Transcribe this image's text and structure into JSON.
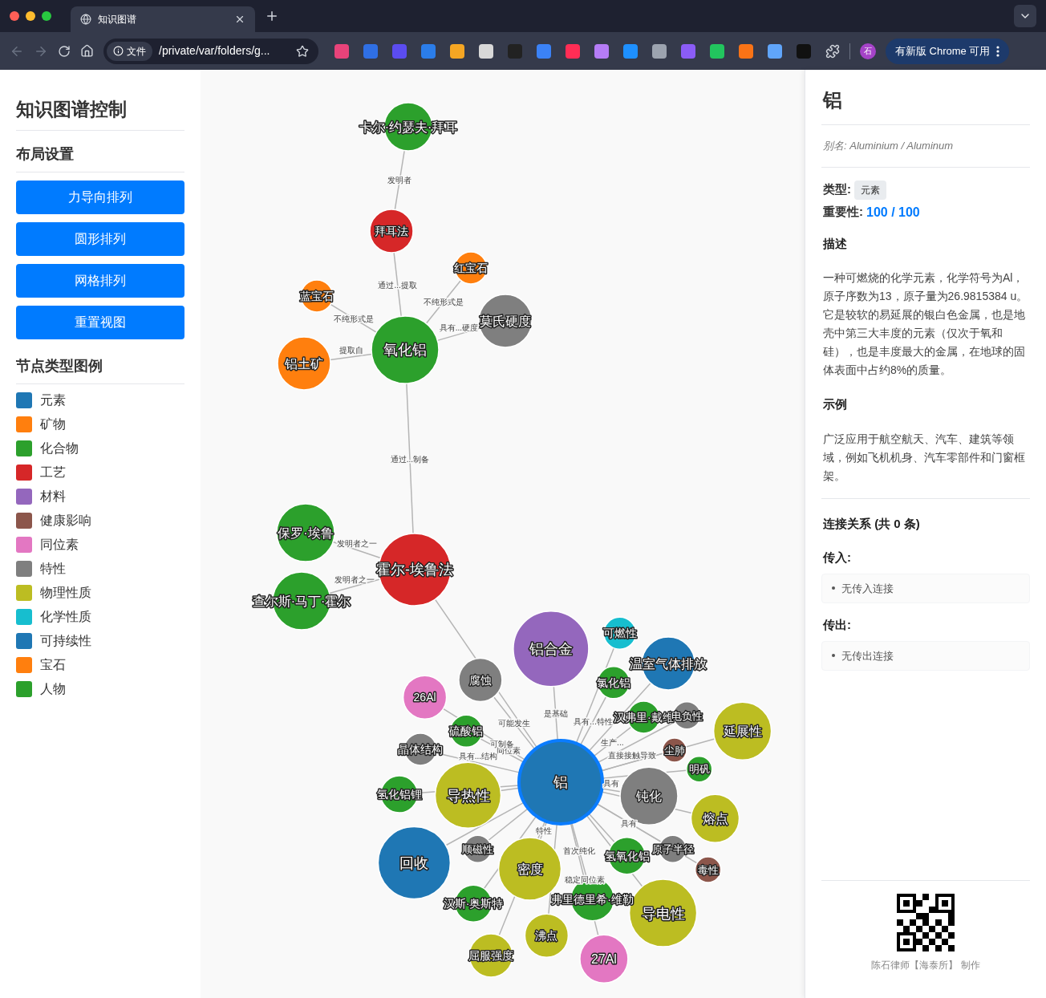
{
  "browser": {
    "tab_title": "知识图谱",
    "address_badge": "文件",
    "url": "/private/var/folders/g...",
    "profile": "石",
    "update_button": "有新版 Chrome 可用"
  },
  "sidebar": {
    "title": "知识图谱控制",
    "layout_heading": "布局设置",
    "buttons": [
      "力导向排列",
      "圆形排列",
      "网格排列",
      "重置视图"
    ],
    "legend_heading": "节点类型图例",
    "legend": [
      {
        "label": "元素",
        "color": "#1f77b4"
      },
      {
        "label": "矿物",
        "color": "#ff7f0e"
      },
      {
        "label": "化合物",
        "color": "#2ca02c"
      },
      {
        "label": "工艺",
        "color": "#d62728"
      },
      {
        "label": "材料",
        "color": "#9467bd"
      },
      {
        "label": "健康影响",
        "color": "#8c564b"
      },
      {
        "label": "同位素",
        "color": "#e377c2"
      },
      {
        "label": "特性",
        "color": "#7f7f7f"
      },
      {
        "label": "物理性质",
        "color": "#bcbd22"
      },
      {
        "label": "化学性质",
        "color": "#17becf"
      },
      {
        "label": "可持续性",
        "color": "#1f77b4"
      },
      {
        "label": "宝石",
        "color": "#ff7f0e"
      },
      {
        "label": "人物",
        "color": "#2ca02c"
      }
    ]
  },
  "graph": {
    "nodes": [
      {
        "label": "卡尔·约瑟夫·拜耳",
        "color": "#2ca02c",
        "selected": false
      },
      {
        "label": "拜耳法",
        "color": "#d62728",
        "selected": false
      },
      {
        "label": "红宝石",
        "color": "#ff7f0e",
        "selected": false
      },
      {
        "label": "蓝宝石",
        "color": "#ff7f0e",
        "selected": false
      },
      {
        "label": "莫氏硬度",
        "color": "#7f7f7f",
        "selected": false
      },
      {
        "label": "氧化铝",
        "color": "#2ca02c",
        "selected": false
      },
      {
        "label": "铝土矿",
        "color": "#ff7f0e",
        "selected": false
      },
      {
        "label": "保罗·埃鲁",
        "color": "#2ca02c",
        "selected": false
      },
      {
        "label": "霍尔-埃鲁法",
        "color": "#d62728",
        "selected": false
      },
      {
        "label": "查尔斯·马丁·霍尔",
        "color": "#2ca02c",
        "selected": false
      },
      {
        "label": "铝合金",
        "color": "#9467bd",
        "selected": false
      },
      {
        "label": "可燃性",
        "color": "#17becf",
        "selected": false
      },
      {
        "label": "温室气体排放",
        "color": "#1f77b4",
        "selected": false
      },
      {
        "label": "氯化铝",
        "color": "#2ca02c",
        "selected": false
      },
      {
        "label": "腐蚀",
        "color": "#7f7f7f",
        "selected": false
      },
      {
        "label": "26Al",
        "color": "#e377c2",
        "selected": false
      },
      {
        "label": "汉弗里·戴维",
        "color": "#2ca02c",
        "selected": false
      },
      {
        "label": "电负性",
        "color": "#7f7f7f",
        "selected": false
      },
      {
        "label": "延展性",
        "color": "#bcbd22",
        "selected": false
      },
      {
        "label": "硫酸铝",
        "color": "#2ca02c",
        "selected": false
      },
      {
        "label": "尘肺",
        "color": "#8c564b",
        "selected": false
      },
      {
        "label": "晶体结构",
        "color": "#7f7f7f",
        "selected": false
      },
      {
        "label": "明矾",
        "color": "#2ca02c",
        "selected": false
      },
      {
        "label": "氢化铝锂",
        "color": "#2ca02c",
        "selected": false
      },
      {
        "label": "导热性",
        "color": "#bcbd22",
        "selected": false
      },
      {
        "label": "钝化",
        "color": "#7f7f7f",
        "selected": false
      },
      {
        "label": "熔点",
        "color": "#bcbd22",
        "selected": false
      },
      {
        "label": "回收",
        "color": "#1f77b4",
        "selected": false
      },
      {
        "label": "顺磁性",
        "color": "#7f7f7f",
        "selected": false
      },
      {
        "label": "密度",
        "color": "#bcbd22",
        "selected": false
      },
      {
        "label": "氢氧化铝",
        "color": "#2ca02c",
        "selected": false
      },
      {
        "label": "原子半径",
        "color": "#7f7f7f",
        "selected": false
      },
      {
        "label": "毒性",
        "color": "#8c564b",
        "selected": false
      },
      {
        "label": "汉斯·奥斯特",
        "color": "#2ca02c",
        "selected": false
      },
      {
        "label": "弗里德里希·维勒",
        "color": "#2ca02c",
        "selected": false
      },
      {
        "label": "导电性",
        "color": "#bcbd22",
        "selected": false
      },
      {
        "label": "沸点",
        "color": "#bcbd22",
        "selected": false
      },
      {
        "label": "屈服强度",
        "color": "#bcbd22",
        "selected": false
      },
      {
        "label": "27Al",
        "color": "#e377c2",
        "selected": false
      },
      {
        "label": "铝",
        "color": "#1f77b4",
        "selected": true
      }
    ],
    "edge_labels": [
      "发明者",
      "通过...提取",
      "不纯形式是",
      "不纯形式是",
      "具有...硬度",
      "提取自",
      "通过...制备",
      "发明者之一",
      "发明者之一",
      "是基础",
      "具有...特性",
      "可能发生",
      "同位素",
      "生产...",
      "可制备",
      "直接接触导致",
      "具有...结构",
      "具有",
      "特性",
      "具有",
      "首次纯化",
      "稳定同位素"
    ]
  },
  "details": {
    "title": "铝",
    "alias": "别名: Aluminium / Aluminum",
    "type_label": "类型:",
    "type": "元素",
    "importance_label": "重要性:",
    "importance": "100 / 100",
    "description_heading": "描述",
    "description": "一种可燃烧的化学元素，化学符号为Al，原子序数为13，原子量为26.9815384 u。它是较软的易延展的银白色金属，也是地壳中第三大丰度的元素（仅次于氧和硅），也是丰度最大的金属，在地球的固体表面中占约8%的质量。",
    "examples_heading": "示例",
    "examples": "广泛应用于航空航天、汽车、建筑等领域，例如飞机机身、汽车零部件和门窗框架。",
    "connections_heading": "连接关系 (共 0 条)",
    "incoming_heading": "传入:",
    "incoming_empty": "无传入连接",
    "outgoing_heading": "传出:",
    "outgoing_empty": "无传出连接",
    "footer": "陈石律师【海泰所】 制作"
  }
}
